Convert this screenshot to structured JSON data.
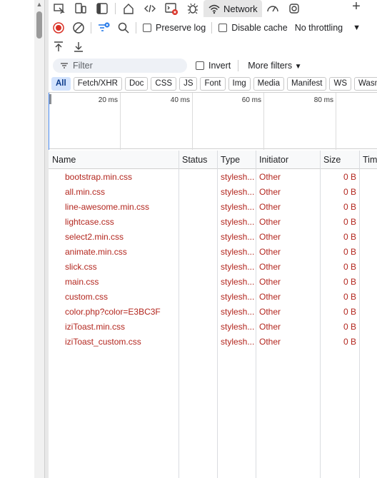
{
  "tabbar": {
    "network_label": "Network"
  },
  "toolbar": {
    "preserve_log": "Preserve log",
    "disable_cache": "Disable cache",
    "throttling": "No throttling"
  },
  "filter": {
    "placeholder": "Filter",
    "invert": "Invert",
    "more_filters": "More filters"
  },
  "chips": [
    "All",
    "Fetch/XHR",
    "Doc",
    "CSS",
    "JS",
    "Font",
    "Img",
    "Media",
    "Manifest",
    "WS",
    "Wasm"
  ],
  "overview": {
    "ticks": [
      "20 ms",
      "40 ms",
      "60 ms",
      "80 ms"
    ]
  },
  "table": {
    "columns": [
      "Name",
      "Status",
      "Type",
      "Initiator",
      "Size",
      "Tim"
    ],
    "rows": [
      {
        "name": "bootstrap.min.css",
        "type": "stylesh...",
        "initiator": "Other",
        "size": "0 B"
      },
      {
        "name": "all.min.css",
        "type": "stylesh...",
        "initiator": "Other",
        "size": "0 B"
      },
      {
        "name": "line-awesome.min.css",
        "type": "stylesh...",
        "initiator": "Other",
        "size": "0 B"
      },
      {
        "name": "lightcase.css",
        "type": "stylesh...",
        "initiator": "Other",
        "size": "0 B"
      },
      {
        "name": "select2.min.css",
        "type": "stylesh...",
        "initiator": "Other",
        "size": "0 B"
      },
      {
        "name": "animate.min.css",
        "type": "stylesh...",
        "initiator": "Other",
        "size": "0 B"
      },
      {
        "name": "slick.css",
        "type": "stylesh...",
        "initiator": "Other",
        "size": "0 B"
      },
      {
        "name": "main.css",
        "type": "stylesh...",
        "initiator": "Other",
        "size": "0 B"
      },
      {
        "name": "custom.css",
        "type": "stylesh...",
        "initiator": "Other",
        "size": "0 B"
      },
      {
        "name": "color.php?color=E3BC3F",
        "type": "stylesh...",
        "initiator": "Other",
        "size": "0 B"
      },
      {
        "name": "iziToast.min.css",
        "type": "stylesh...",
        "initiator": "Other",
        "size": "0 B"
      },
      {
        "name": "iziToast_custom.css",
        "type": "stylesh...",
        "initiator": "Other",
        "size": "0 B"
      }
    ]
  },
  "colors": {
    "error_text": "#b3261e",
    "record_red": "#d93025",
    "active_chip": "#d3e3fd",
    "filter_bg": "#eef1f6"
  }
}
